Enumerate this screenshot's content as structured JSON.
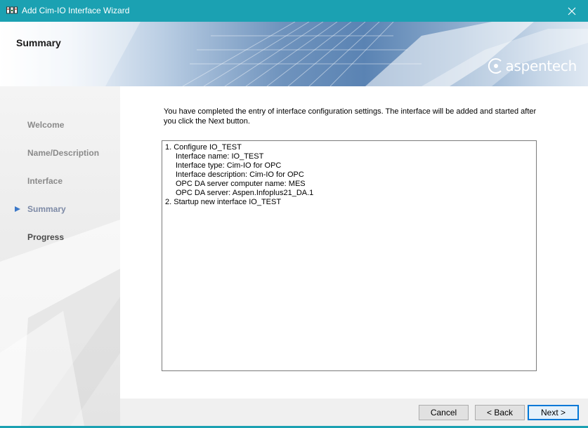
{
  "window": {
    "title": "Add Cim-IO Interface Wizard",
    "app_icon": "cim-io-interface-icon",
    "close_icon": "close-icon",
    "accent": "#1ba1b2"
  },
  "banner": {
    "heading": "Summary",
    "brand": "aspentech"
  },
  "steps": [
    {
      "label": "Welcome",
      "state": "done"
    },
    {
      "label": "Name/Description",
      "state": "done"
    },
    {
      "label": "Interface",
      "state": "done"
    },
    {
      "label": "Summary",
      "state": "current"
    },
    {
      "label": "Progress",
      "state": "pending"
    }
  ],
  "main": {
    "intro": "You have completed the entry of interface configuration settings.  The interface will be added and started after you click the Next button.",
    "summary_lines": [
      {
        "text": "1. Configure IO_TEST",
        "indent": false
      },
      {
        "text": "Interface name: IO_TEST",
        "indent": true
      },
      {
        "text": "Interface type: Cim-IO for OPC",
        "indent": true
      },
      {
        "text": "Interface description: Cim-IO for OPC",
        "indent": true
      },
      {
        "text": "OPC DA server computer name: MES",
        "indent": true
      },
      {
        "text": "OPC DA server: Aspen.Infoplus21_DA.1",
        "indent": true
      },
      {
        "text": "2. Startup new interface IO_TEST",
        "indent": false
      }
    ]
  },
  "buttons": {
    "cancel": "Cancel",
    "back": "< Back",
    "next": "Next >"
  }
}
